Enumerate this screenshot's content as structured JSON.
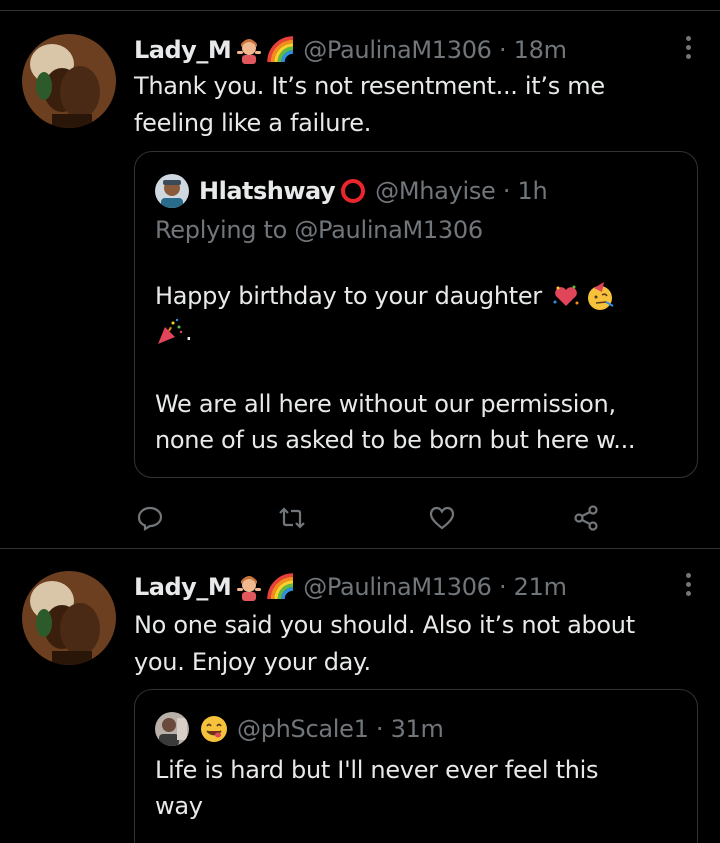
{
  "colors": {
    "background": "#000000",
    "text": "#e7e9ea",
    "muted": "#71767b",
    "border": "#2f3336"
  },
  "tweets": [
    {
      "display_name": "Lady_M",
      "badges": [
        "woman-gesturing-emoji",
        "rainbow-emoji"
      ],
      "handle_time": "@PaulinaM1306 · 18m",
      "text_line_1": "Thank you. It’s not resentment... it’s me",
      "text_line_2": "feeling like a failure.",
      "quote": {
        "name": "Hlatshway",
        "name_badge": "red-ring-emoji",
        "handle_time": "@Mhayise · 1h",
        "replying_to": "Replying to @PaulinaM1306",
        "line_1": "Happy birthday to your daughter",
        "line_1_emojis": [
          "heart-confetti-emoji",
          "party-face-emoji"
        ],
        "line_2_emojis": [
          "party-popper-emoji"
        ],
        "line_2_suffix": ".",
        "line_3": "We are all here without our permission,",
        "line_4": "none of us asked to be born but here w..."
      },
      "actions": [
        "reply-icon",
        "retweet-icon",
        "like-icon",
        "share-icon"
      ]
    },
    {
      "display_name": "Lady_M",
      "badges": [
        "woman-gesturing-emoji",
        "rainbow-emoji"
      ],
      "handle_time": "@PaulinaM1306 · 21m",
      "text_line_1": "No one said you should. Also it’s not about",
      "text_line_2": "you. Enjoy your day.",
      "quote": {
        "name_emoji": "yum-face-emoji",
        "handle_time": "@phScale1 · 31m",
        "line_1": "Life is hard but I'll never ever feel this",
        "line_2": "way"
      }
    }
  ]
}
